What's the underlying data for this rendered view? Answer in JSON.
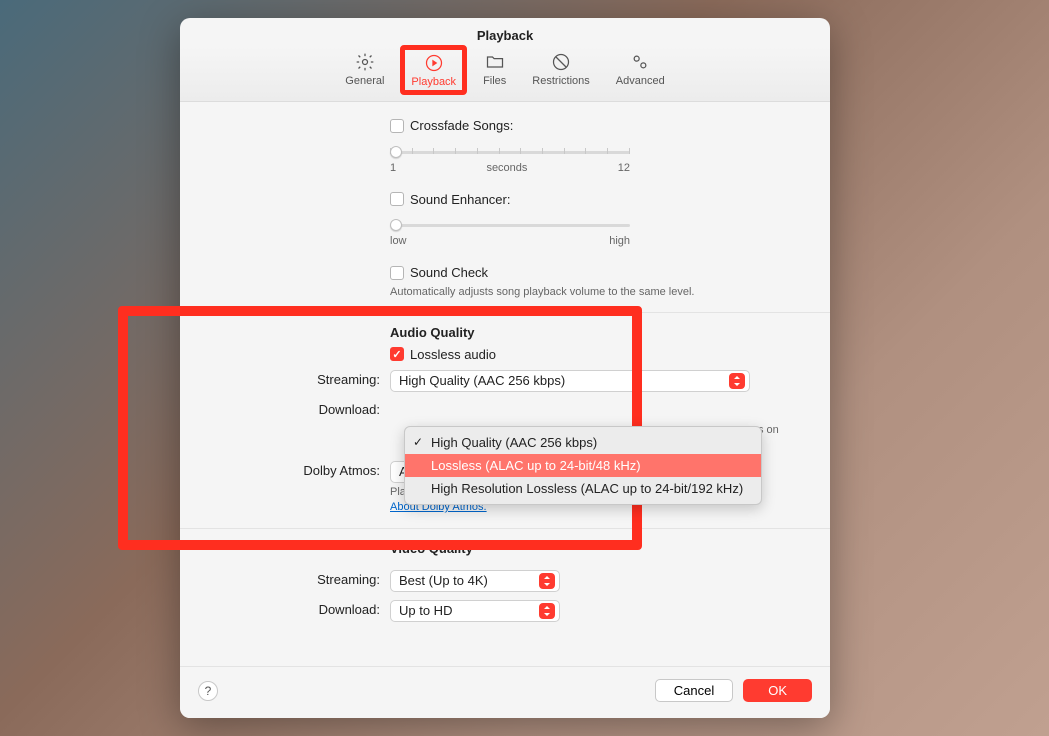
{
  "window": {
    "title": "Playback"
  },
  "tabs": {
    "general": "General",
    "playback": "Playback",
    "files": "Files",
    "restrictions": "Restrictions",
    "advanced": "Advanced"
  },
  "crossfade": {
    "label": "Crossfade Songs:",
    "min": "1",
    "unit": "seconds",
    "max": "12"
  },
  "enhancer": {
    "label": "Sound Enhancer:",
    "low": "low",
    "high": "high"
  },
  "soundcheck": {
    "label": "Sound Check",
    "desc": "Automatically adjusts song playback volume to the same level."
  },
  "audio": {
    "heading": "Audio Quality",
    "lossless_label": "Lossless audio",
    "streaming_label": "Streaming:",
    "streaming_value": "High Quality (AAC 256 kbps)",
    "download_label": "Download:",
    "download_trail": "s on",
    "dolby_label": "Dolby Atmos:",
    "dolby_value": "Automatic",
    "dolby_desc": "Play supported songs in Dolby Atmos and other Dolby Audio formats.",
    "dolby_link": "About Dolby Atmos."
  },
  "dropdown": {
    "opt1": "High Quality (AAC 256 kbps)",
    "opt2": "Lossless (ALAC up to 24-bit/48 kHz)",
    "opt3": "High Resolution Lossless (ALAC up to 24-bit/192 kHz)"
  },
  "video": {
    "heading": "Video Quality",
    "streaming_label": "Streaming:",
    "streaming_value": "Best (Up to 4K)",
    "download_label": "Download:",
    "download_value": "Up to HD"
  },
  "footer": {
    "help": "?",
    "cancel": "Cancel",
    "ok": "OK"
  }
}
